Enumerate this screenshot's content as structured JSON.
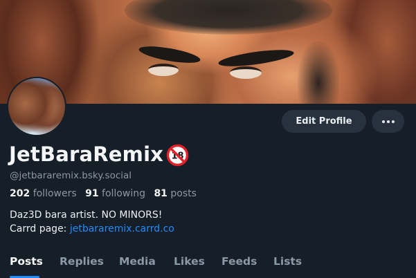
{
  "profile": {
    "display_name": "JetBaraRemix",
    "handle": "@jetbararemix.bsky.social",
    "nsfw_badge_label": "18",
    "stats": {
      "followers_count": "202",
      "followers_label": "followers",
      "following_count": "91",
      "following_label": "following",
      "posts_count": "81",
      "posts_label": "posts"
    },
    "bio_line1": "Daz3D bara artist. NO MINORS!",
    "bio_line2_prefix": "Carrd page: ",
    "bio_link": "jetbararemix.carrd.co"
  },
  "actions": {
    "edit_profile_label": "Edit Profile",
    "more_icon": "more-horizontal-icon"
  },
  "tabs": [
    {
      "label": "Posts",
      "active": true
    },
    {
      "label": "Replies",
      "active": false
    },
    {
      "label": "Media",
      "active": false
    },
    {
      "label": "Likes",
      "active": false
    },
    {
      "label": "Feeds",
      "active": false
    },
    {
      "label": "Lists",
      "active": false
    }
  ],
  "colors": {
    "background": "#161e27",
    "accent": "#208bfe",
    "muted_text": "#8b98a6",
    "button_bg": "#28323e",
    "nsfw_red": "#e0222a"
  }
}
